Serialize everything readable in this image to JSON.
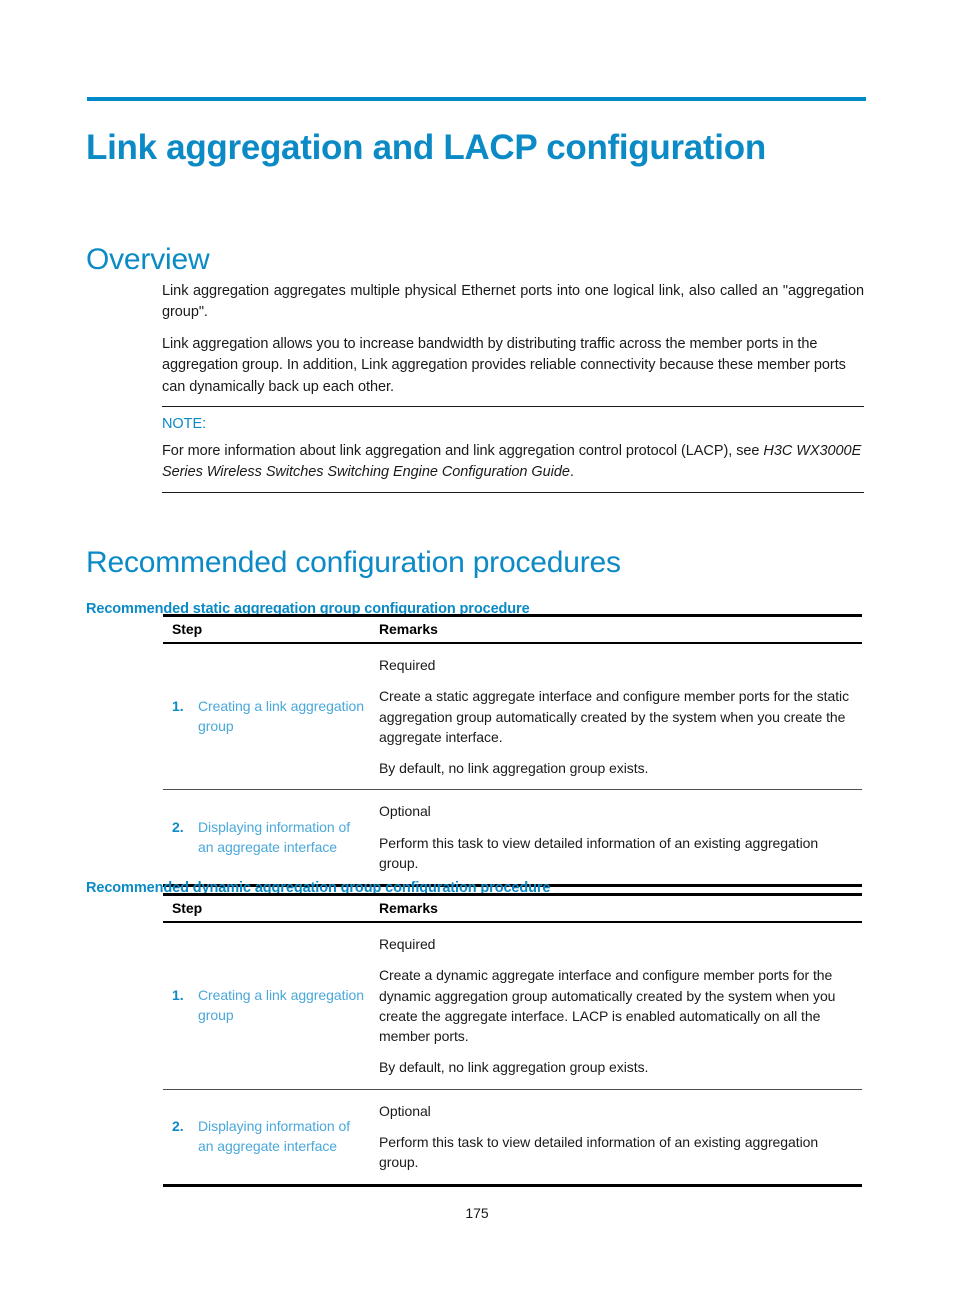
{
  "document": {
    "title": "Link aggregation and LACP configuration",
    "page_number": "175",
    "accent_color": "#0b8ac6",
    "link_color": "#4aa8da",
    "rule_color": "#0089c8"
  },
  "overview": {
    "heading": "Overview",
    "paragraph_1": "Link aggregation aggregates multiple physical Ethernet ports into one logical link, also called an \"aggregation group\".",
    "paragraph_2": "Link aggregation allows you to increase bandwidth by distributing traffic across the member ports in the aggregation group. In addition, Link aggregation provides reliable connectivity because these member ports can dynamically back up each other."
  },
  "note": {
    "label": "NOTE:",
    "text_plain": "For more information about link aggregation and link aggregation control protocol (LACP), see ",
    "text_italic": "H3C WX3000E Series Wireless Switches Switching Engine Configuration Guide",
    "text_tail": "."
  },
  "recommended": {
    "heading": "Recommended configuration procedures",
    "static": {
      "heading": "Recommended static aggregation group configuration procedure",
      "columns": [
        "Step",
        "Remarks"
      ],
      "rows": [
        {
          "number": "1.",
          "step_link": "Creating a link aggregation group",
          "remarks": [
            "Required",
            "Create a static aggregate interface and configure member ports for the static aggregation group automatically created by the system when you create the aggregate interface.",
            "By default, no link aggregation group exists."
          ]
        },
        {
          "number": "2.",
          "step_link": "Displaying information of an aggregate interface",
          "remarks": [
            "Optional",
            "Perform this task to view detailed information of an existing aggregation group."
          ]
        }
      ]
    },
    "dynamic": {
      "heading": "Recommended dynamic aggregation group configuration procedure",
      "columns": [
        "Step",
        "Remarks"
      ],
      "rows": [
        {
          "number": "1.",
          "step_link": "Creating a link aggregation group",
          "remarks": [
            "Required",
            "Create a dynamic aggregate interface and configure member ports for the dynamic aggregation group automatically created by the system when you create the aggregate interface. LACP is enabled automatically on all the member ports.",
            "By default, no link aggregation group exists."
          ]
        },
        {
          "number": "2.",
          "step_link": "Displaying information of an aggregate interface",
          "remarks": [
            "Optional",
            "Perform this task to view detailed information of an existing aggregation group."
          ]
        }
      ]
    }
  }
}
